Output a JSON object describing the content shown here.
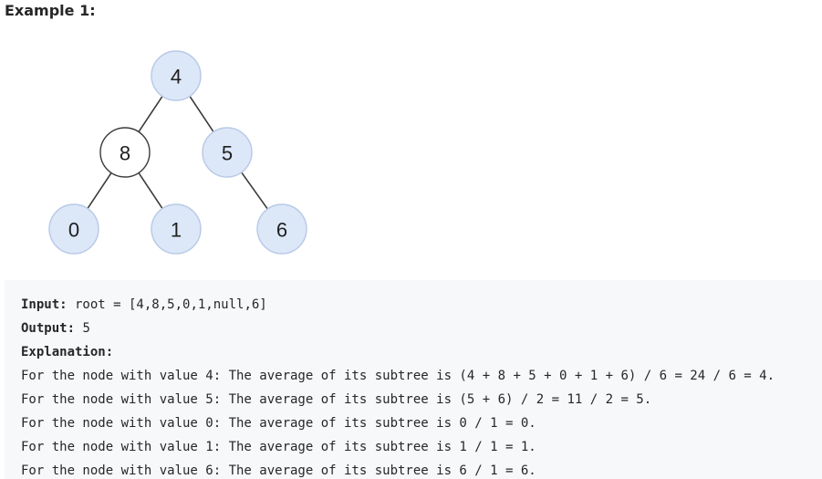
{
  "example": {
    "title": "Example 1:"
  },
  "tree": {
    "nodes": [
      {
        "id": "n4",
        "value": "4",
        "highlighted": true
      },
      {
        "id": "n8",
        "value": "8",
        "highlighted": false
      },
      {
        "id": "n5",
        "value": "5",
        "highlighted": true
      },
      {
        "id": "n0",
        "value": "0",
        "highlighted": true
      },
      {
        "id": "n1",
        "value": "1",
        "highlighted": true
      },
      {
        "id": "n6",
        "value": "6",
        "highlighted": true
      }
    ],
    "edges": [
      [
        "n4",
        "n8"
      ],
      [
        "n4",
        "n5"
      ],
      [
        "n8",
        "n0"
      ],
      [
        "n8",
        "n1"
      ],
      [
        "n5",
        "n6"
      ]
    ],
    "colors": {
      "highlight_fill": "#dce7f8",
      "highlight_stroke": "#b7c9e6",
      "plain_fill": "#ffffff",
      "plain_stroke": "#3a3a3a"
    }
  },
  "io": {
    "input_label": "Input:",
    "input_value": " root = [4,8,5,0,1,null,6]",
    "output_label": "Output:",
    "output_value": " 5",
    "explanation_label": "Explanation:",
    "explanation_lines": [
      "For the node with value 4: The average of its subtree is (4 + 8 + 5 + 0 + 1 + 6) / 6 = 24 / 6 = 4.",
      "For the node with value 5: The average of its subtree is (5 + 6) / 2 = 11 / 2 = 5.",
      "For the node with value 0: The average of its subtree is 0 / 1 = 0.",
      "For the node with value 1: The average of its subtree is 1 / 1 = 1.",
      "For the node with value 6: The average of its subtree is 6 / 1 = 6."
    ]
  }
}
